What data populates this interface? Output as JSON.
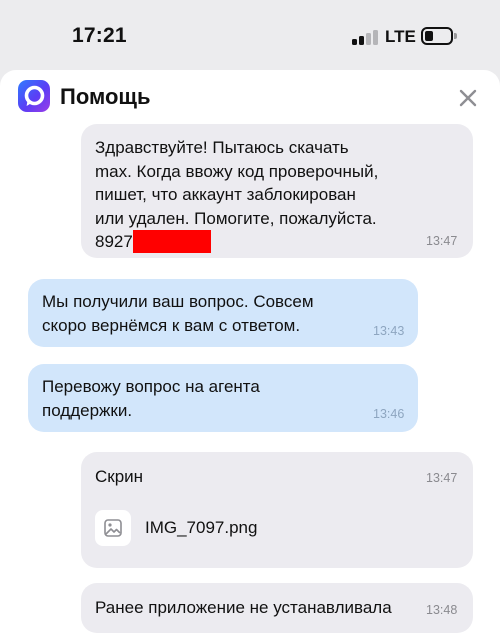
{
  "status_bar": {
    "time": "17:21",
    "network": "LTE"
  },
  "header": {
    "app_icon": "max-logo-icon",
    "title": "Помощь",
    "close_icon": "close-icon"
  },
  "messages": [
    {
      "direction": "outgoing",
      "lines": [
        "Здравствуйте! Пытаюсь скачать",
        "max. Когда ввожу код проверочный,",
        "пишет, что аккаунт заблокирован",
        "или удален. Помогите, пожалуйста."
      ],
      "phone_prefix": "8927",
      "time": "13:47"
    },
    {
      "direction": "incoming",
      "lines": [
        "Мы получили ваш вопрос. Совсем",
        "скоро вернёмся к вам с ответом."
      ],
      "time": "13:43"
    },
    {
      "direction": "incoming",
      "lines": [
        "Перевожу вопрос на агента",
        "поддержки."
      ],
      "time": "13:46"
    },
    {
      "direction": "outgoing",
      "lines": [
        "Скрин"
      ],
      "attachment": {
        "icon": "image-file-icon",
        "name": "IMG_7097.png"
      },
      "time": "13:47"
    },
    {
      "direction": "outgoing",
      "lines": [
        "Ранее приложение не устанавливала"
      ],
      "time": "13:48"
    }
  ],
  "colors": {
    "outgoing_bubble": "#ecebf0",
    "incoming_bubble": "#d2e6fb",
    "redaction": "#ff0000"
  }
}
